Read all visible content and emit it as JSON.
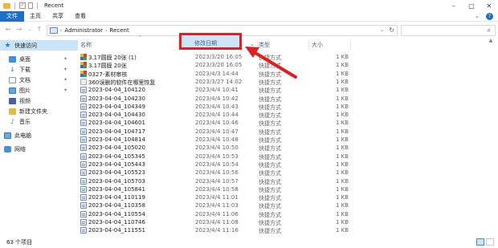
{
  "window": {
    "title": "Recent"
  },
  "ribbon": {
    "tabs": [
      "文件",
      "主页",
      "共享",
      "查看"
    ]
  },
  "address": {
    "crumbs": [
      "Administrator",
      "Recent"
    ]
  },
  "sidebar": {
    "items": [
      {
        "label": "快速访问",
        "icon": "star-icon",
        "pinned": false
      },
      {
        "label": "桌面",
        "icon": "desktop-icon",
        "pinned": true
      },
      {
        "label": "下载",
        "icon": "download-icon",
        "pinned": true
      },
      {
        "label": "文档",
        "icon": "document-icon",
        "pinned": true
      },
      {
        "label": "图片",
        "icon": "picture-icon",
        "pinned": true
      },
      {
        "label": "视频",
        "icon": "video-icon",
        "pinned": false
      },
      {
        "label": "新建文件夹",
        "icon": "folder-icon",
        "pinned": false
      },
      {
        "label": "音乐",
        "icon": "music-icon",
        "pinned": false
      },
      {
        "label": "此电脑",
        "icon": "pc-icon",
        "pinned": false
      },
      {
        "label": "网络",
        "icon": "network-icon",
        "pinned": false
      }
    ]
  },
  "columns": {
    "name": "名称",
    "date": "修改日期",
    "type": "类型",
    "size": "大小"
  },
  "files": [
    {
      "name": "3.17圆膜 20张 (1)",
      "date": "2023/3/20 16:05",
      "type": "快捷方式",
      "size": "1 KB",
      "icon": "color-file-icon"
    },
    {
      "name": "3.17圆膜 20张",
      "date": "2023/3/20 16:05",
      "type": "快捷方式",
      "size": "1 KB",
      "icon": "color-file-icon"
    },
    {
      "name": "0327-素材审核",
      "date": "2023/4/3 14:44",
      "type": "快捷方式",
      "size": "1 KB",
      "icon": "color-file-icon"
    },
    {
      "name": "360误删的软件在哪里恢复",
      "date": "2023/3/27 14:02",
      "type": "快捷方式",
      "size": "1 KB",
      "icon": "app-shortcut-icon"
    },
    {
      "name": "2023-04-04_104120",
      "date": "2023/4/4 10:41",
      "type": "快捷方式",
      "size": "1 KB",
      "icon": "shortcut-icon"
    },
    {
      "name": "2023-04-04_104230",
      "date": "2023/4/4 10:42",
      "type": "快捷方式",
      "size": "1 KB",
      "icon": "shortcut-icon"
    },
    {
      "name": "2023-04-04_104349",
      "date": "2023/4/4 10:43",
      "type": "快捷方式",
      "size": "1 KB",
      "icon": "shortcut-icon"
    },
    {
      "name": "2023-04-04_104430",
      "date": "2023/4/4 10:44",
      "type": "快捷方式",
      "size": "1 KB",
      "icon": "shortcut-icon"
    },
    {
      "name": "2023-04-04_104601",
      "date": "2023/4/4 10:46",
      "type": "快捷方式",
      "size": "1 KB",
      "icon": "shortcut-icon"
    },
    {
      "name": "2023-04-04_104717",
      "date": "2023/4/4 10:47",
      "type": "快捷方式",
      "size": "1 KB",
      "icon": "shortcut-icon"
    },
    {
      "name": "2023-04-04_104814",
      "date": "2023/4/4 10:48",
      "type": "快捷方式",
      "size": "1 KB",
      "icon": "shortcut-icon"
    },
    {
      "name": "2023-04-04_105020",
      "date": "2023/4/4 10:50",
      "type": "快捷方式",
      "size": "1 KB",
      "icon": "shortcut-icon"
    },
    {
      "name": "2023-04-04_105345",
      "date": "2023/4/4 10:53",
      "type": "快捷方式",
      "size": "1 KB",
      "icon": "shortcut-icon"
    },
    {
      "name": "2023-04-04_105443",
      "date": "2023/4/4 10:54",
      "type": "快捷方式",
      "size": "1 KB",
      "icon": "shortcut-icon"
    },
    {
      "name": "2023-04-04_105523",
      "date": "2023/4/4 10:56",
      "type": "快捷方式",
      "size": "1 KB",
      "icon": "shortcut-icon"
    },
    {
      "name": "2023-04-04_105703",
      "date": "2023/4/4 10:57",
      "type": "快捷方式",
      "size": "1 KB",
      "icon": "shortcut-icon"
    },
    {
      "name": "2023-04-04_105841",
      "date": "2023/4/4 10:58",
      "type": "快捷方式",
      "size": "1 KB",
      "icon": "shortcut-icon"
    },
    {
      "name": "2023-04-04_110119",
      "date": "2023/4/4 11:01",
      "type": "快捷方式",
      "size": "1 KB",
      "icon": "shortcut-icon"
    },
    {
      "name": "2023-04-04_110358",
      "date": "2023/4/4 11:03",
      "type": "快捷方式",
      "size": "1 KB",
      "icon": "shortcut-icon"
    },
    {
      "name": "2023-04-04_110554",
      "date": "2023/4/4 11:06",
      "type": "快捷方式",
      "size": "1 KB",
      "icon": "shortcut-icon"
    },
    {
      "name": "2023-04-04_110746",
      "date": "2023/4/4 11:08",
      "type": "快捷方式",
      "size": "1 KB",
      "icon": "shortcut-icon"
    },
    {
      "name": "2023-04-04_111551",
      "date": "2023/4/4 11:16",
      "type": "快捷方式",
      "size": "1 KB",
      "icon": "shortcut-icon"
    }
  ],
  "status": {
    "item_count": "63 个项目"
  },
  "colors": {
    "accent": "#1a6fc9",
    "highlight": "#e02020",
    "selection": "#cce4f7"
  }
}
